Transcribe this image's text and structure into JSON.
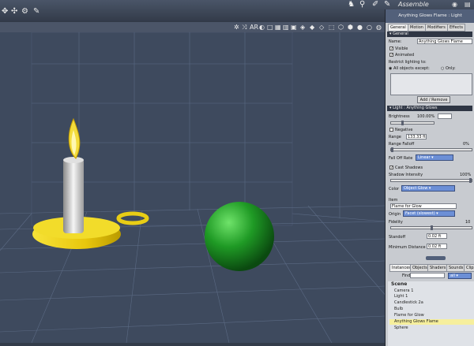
{
  "app": {
    "room_label": "Assemble"
  },
  "viewport": {
    "toolbar_label": "AR"
  },
  "panel": {
    "title": "Anything Glows Flame : Light",
    "tabs": [
      "General",
      "Motion",
      "Modifiers",
      "Effects"
    ],
    "general_section": "General",
    "name_label": "Name:",
    "name_value": "Anything Glows Flame",
    "visible_label": "Visible",
    "animated_label": "Animated",
    "restrict_label": "Restrict lighting to:",
    "all_objects_label": "All objects except:",
    "only_label": "Only:",
    "add_remove_label": "Add / Remove",
    "light_section": "Light",
    "light_type": "Anything Glows",
    "brightness_label": "Brightness",
    "brightness_value": "100.00%",
    "negative_label": "Negative",
    "range_label": "Range",
    "range_value": "133.33 ft",
    "range_falloff_label": "Range Falloff",
    "range_falloff_value": "0%",
    "falloff_rate_label": "Fall Off Rate",
    "falloff_rate_value": "Linear",
    "cast_shadows_label": "Cast Shadows",
    "shadow_intensity_label": "Shadow Intensity",
    "shadow_intensity_value": "100%",
    "color_label": "Color",
    "color_value": "Object Glow",
    "item_label": "Item",
    "item_value": "Flame for Glow",
    "origin_label": "Origin",
    "origin_value": "Facet (slowest)",
    "fidelity_label": "Fidelity",
    "fidelity_value": "10",
    "standoff_label": "Standoff",
    "standoff_value": "0.02 ft",
    "min_distance_label": "Minimum Distance",
    "min_distance_value": "0.02 ft",
    "brightness_level": 0.25,
    "range_falloff_level": 0.0,
    "shadow_intensity_level": 1.0,
    "fidelity_level": 0.5
  },
  "bottom_tabs": [
    "Instances",
    "Objects",
    "Shaders",
    "Sounds",
    "Clips"
  ],
  "find_label": "Find:",
  "find_dropdown": "all",
  "scene": {
    "header": "Scene",
    "items": [
      "Camera 1",
      "Light 1",
      "Candlestick 2a",
      "Bulb",
      "Flame for Glow",
      "Anything Glows Flame",
      "Sphere"
    ],
    "selected_index": 5
  },
  "colors": {
    "accent": "#52607a",
    "selection": "#f6ef9d",
    "dropdown": "#6c8fd6"
  }
}
